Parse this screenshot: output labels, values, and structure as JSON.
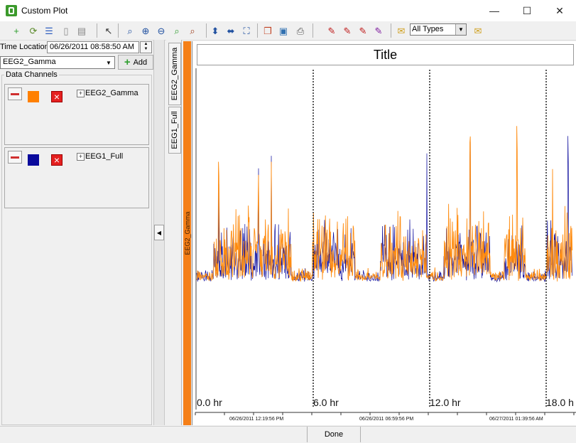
{
  "window": {
    "title": "Custom Plot",
    "min_glyph": "—",
    "max_glyph": "☐",
    "close_glyph": "✕"
  },
  "toolbar": {
    "buttons": [
      {
        "name": "add-channel-icon",
        "glyph": "+",
        "color": "#2e9e2e"
      },
      {
        "name": "refresh-icon",
        "glyph": "⟳",
        "color": "#5a8a2a"
      },
      {
        "name": "channels-list-icon",
        "glyph": "☰",
        "color": "#3060c0"
      },
      {
        "name": "split-pane-icon",
        "glyph": "▯",
        "color": "#888888"
      },
      {
        "name": "stack-icon",
        "glyph": "▤",
        "color": "#888888"
      },
      {
        "name": "pointer-icon",
        "glyph": "↖",
        "color": "#333333"
      },
      {
        "name": "zoom-icon",
        "glyph": "⌕",
        "color": "#2050a0"
      },
      {
        "name": "zoom-in-icon",
        "glyph": "⊕",
        "color": "#2050a0"
      },
      {
        "name": "zoom-out-icon",
        "glyph": "⊖",
        "color": "#2050a0"
      },
      {
        "name": "zoom-fit-icon",
        "glyph": "⌕",
        "color": "#2e9e2e"
      },
      {
        "name": "zoom-reset-icon",
        "glyph": "⌕",
        "color": "#a04020"
      },
      {
        "name": "fit-vertical-icon",
        "glyph": "⬍",
        "color": "#2050a0"
      },
      {
        "name": "fit-horizontal-icon",
        "glyph": "⬌",
        "color": "#2050a0"
      },
      {
        "name": "fit-all-icon",
        "glyph": "⛶",
        "color": "#2050a0"
      },
      {
        "name": "copy-icon",
        "glyph": "❐",
        "color": "#c04020"
      },
      {
        "name": "image-icon",
        "glyph": "▣",
        "color": "#3070b0"
      },
      {
        "name": "print-icon",
        "glyph": "⎙",
        "color": "#555555"
      },
      {
        "name": "annotation-icon",
        "glyph": "✎",
        "color": "#c02020"
      },
      {
        "name": "annotation-prev-icon",
        "glyph": "✎",
        "color": "#c02020"
      },
      {
        "name": "annotation-add-icon",
        "glyph": "✎",
        "color": "#c02020"
      },
      {
        "name": "annotation-list-icon",
        "glyph": "✎",
        "color": "#8020a0"
      },
      {
        "name": "comment-icon",
        "glyph": "✉",
        "color": "#d0a020"
      },
      {
        "name": "comment-next-icon",
        "glyph": "✉",
        "color": "#d0a020"
      }
    ],
    "types_select": "All Types"
  },
  "left_panel": {
    "time_label": "Time Location",
    "time_value": "06/26/2011 08:58:50 AM",
    "channel_select": "EEG2_Gamma",
    "add_label": "Add",
    "data_channels_label": "Data Channels",
    "channels": [
      {
        "name": "EEG2_Gamma",
        "color": "#ff8000",
        "expander": "+"
      },
      {
        "name": "EEG1_Full",
        "color": "#0a0a9c",
        "expander": "+"
      }
    ]
  },
  "tabs": [
    "EEG2_Gamma",
    "EEG1_Full"
  ],
  "plot": {
    "title": "Title",
    "strip_label": "EEG2_Gamma",
    "hour_labels": [
      "0.0 hr",
      "6.0 hr",
      "12.0 hr",
      "18.0 h"
    ],
    "date_labels": [
      "06/26/2011 12:19:56 PM",
      "06/26/2011 06:59:56 PM",
      "06/27/2011 01:39:56 AM"
    ],
    "series_colors": {
      "EEG1_Full": "#0a0a9c",
      "EEG2_Gamma": "#ff8c10"
    }
  },
  "status": {
    "text": "Done"
  }
}
